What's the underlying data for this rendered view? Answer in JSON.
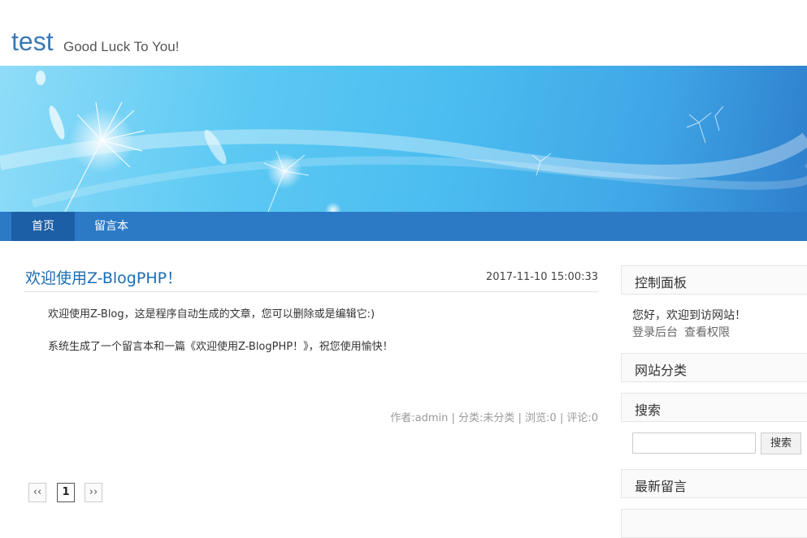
{
  "header": {
    "title": "test",
    "subtitle": "Good Luck To You!"
  },
  "nav": {
    "items": [
      {
        "label": "首页"
      },
      {
        "label": "留言本"
      }
    ]
  },
  "post": {
    "title": "欢迎使用Z-BlogPHP！",
    "date": "2017-11-10 15:00:33",
    "paragraphs": [
      "欢迎使用Z-Blog，这是程序自动生成的文章，您可以删除或是编辑它:)",
      "系统生成了一个留言本和一篇《欢迎使用Z-BlogPHP！》，祝您使用愉快！"
    ],
    "meta": "作者:admin | 分类:未分类 | 浏览:0 | 评论:0"
  },
  "pagination": {
    "prev": "‹‹",
    "current": "1",
    "next": "››"
  },
  "sidebar": {
    "control": {
      "title": "控制面板",
      "greeting": "您好，欢迎到访网站！",
      "login": "登录后台",
      "permissions": "查看权限"
    },
    "categories": {
      "title": "网站分类"
    },
    "search": {
      "title": "搜索",
      "button": "搜索",
      "value": ""
    },
    "comments": {
      "title": "最新留言"
    }
  }
}
